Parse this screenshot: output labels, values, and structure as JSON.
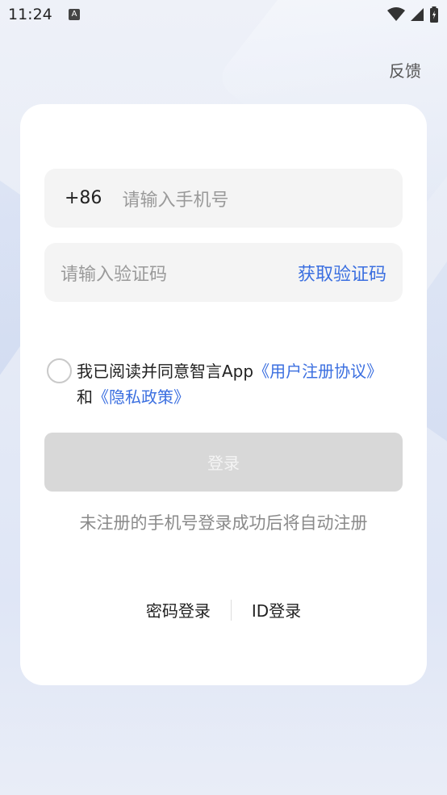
{
  "status_bar": {
    "time": "11:24",
    "notification_icon": "A"
  },
  "header": {
    "feedback_label": "反馈"
  },
  "form": {
    "phone": {
      "prefix": "+86",
      "placeholder": "请输入手机号"
    },
    "code": {
      "placeholder": "请输入验证码",
      "get_code_label": "获取验证码"
    },
    "agreement": {
      "prefix_text": "我已阅读并同意智言App",
      "user_agreement_link": "《用户注册协议》",
      "and_text": "和",
      "privacy_link": "《隐私政策》",
      "checked": false
    },
    "login_button_label": "登录",
    "auto_register_note": "未注册的手机号登录成功后将自动注册",
    "alt_login": {
      "password_label": "密码登录",
      "id_label": "ID登录"
    }
  },
  "colors": {
    "accent": "#3b6fe0",
    "disabled_button": "#d8d8d8"
  }
}
